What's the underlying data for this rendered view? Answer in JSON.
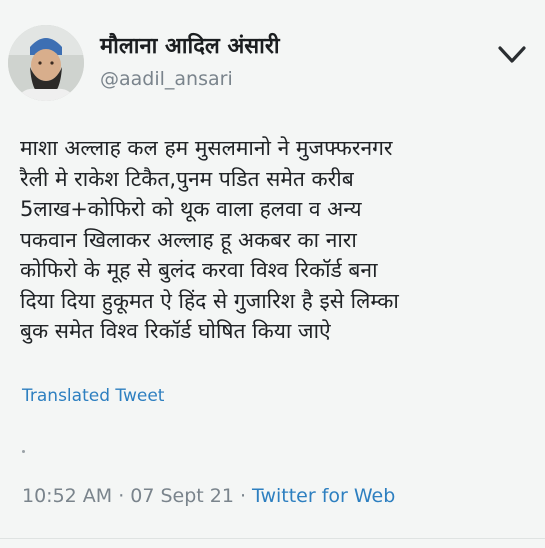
{
  "tweet": {
    "display_name": "मौलाना आदिल अंसारी",
    "handle": "@aadil_ansari",
    "menu_icon": "chevron-down-icon",
    "avatar_icon": "avatar-photo",
    "body": "माशा अल्लाह कल हम मुसलमानो ने मुजफ्फरनगर\nरैली मे राकेश टिकैत,पुनम पडित समेत करीब\n5लाख+कोफिरो को थूक वाला हलवा व अन्य\nपकवान खिलाकर अल्लाह हू अकबर का नारा\nकोफिरो के मूह से बुलंद करवा विश्व रिकॉर्ड बना\nदिया दिया हुकूमत ऐ हिंद से गुजारिश है इसे लिम्का\nबुक समेत विश्व रिकॉर्ड घोषित किया जाऐ",
    "translated_label": "Translated Tweet",
    "time": "10:52 AM",
    "date": "07 Sept 21",
    "source": "Twitter for Web",
    "separator": "·"
  },
  "colors": {
    "background": "#f4f6f5",
    "link": "#2d7fc0",
    "secondary_text": "#7a848c"
  }
}
